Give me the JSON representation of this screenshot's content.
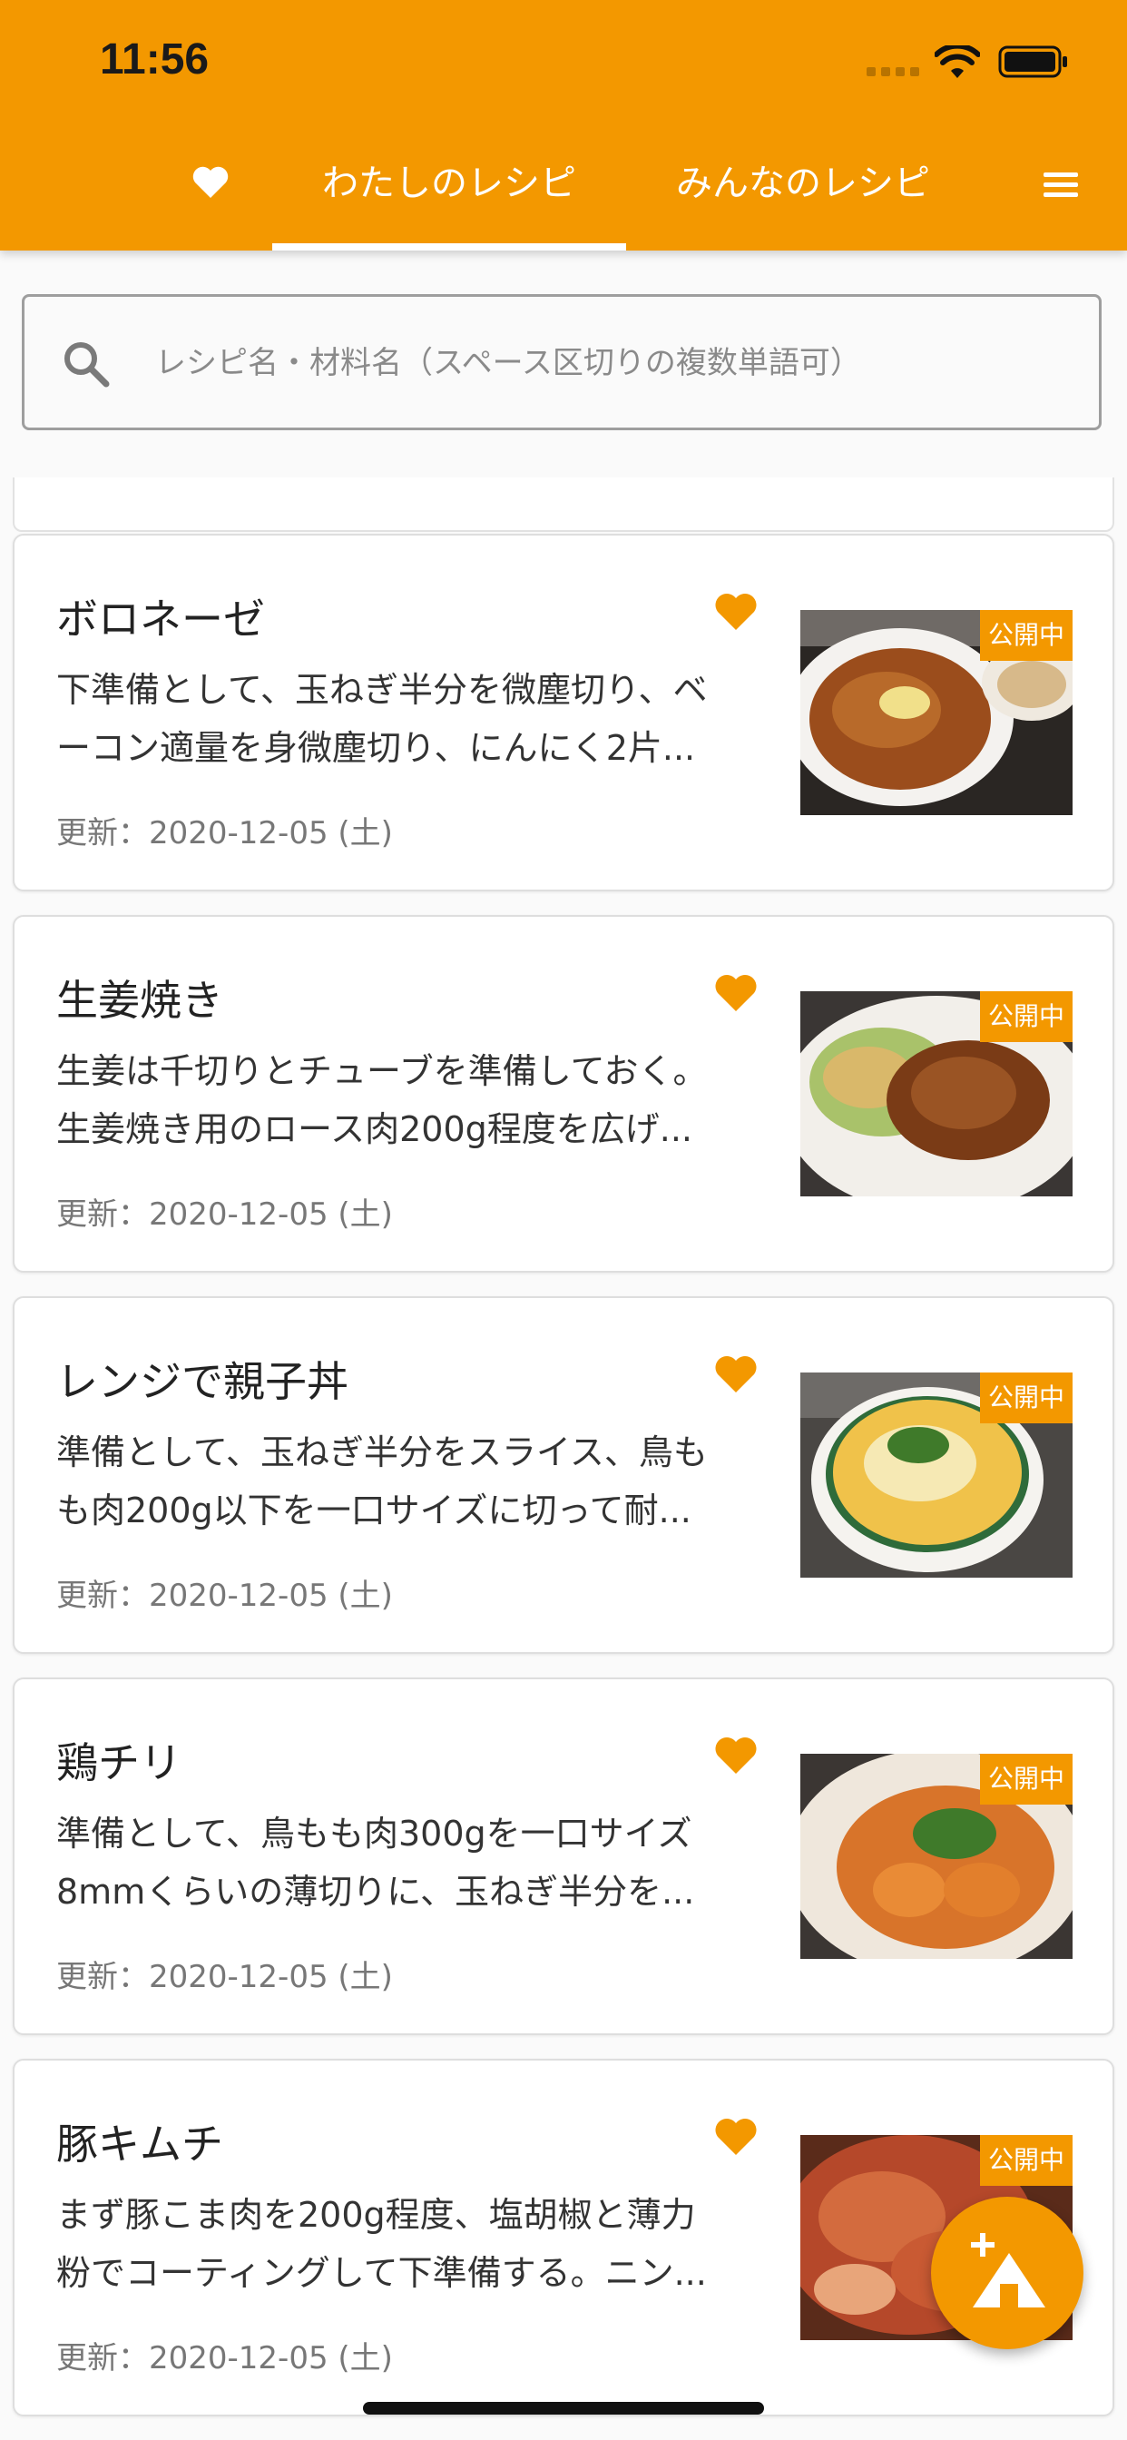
{
  "status_bar": {
    "time": "11:56"
  },
  "app_bar": {
    "tabs": [
      {
        "label": "わたしのレシピ",
        "active": true
      },
      {
        "label": "みんなのレシピ",
        "active": false
      }
    ],
    "colors": {
      "brand": "#F39800",
      "text": "#FFFFFF"
    }
  },
  "search": {
    "placeholder": "レシピ名・材料名（スペース区切りの複数単語可）",
    "value": ""
  },
  "recipes": [
    {
      "title": "ボロネーゼ",
      "desc_line1": "下準備として、玉ねぎ半分を微塵切り、ベ",
      "desc_line2": "ーコン適量を身微塵切り、にんにく2片...",
      "date": "更新：2020-12-05 (土)",
      "badge": "公開中",
      "favorite": true
    },
    {
      "title": "生姜焼き",
      "desc_line1": "生姜は千切りとチューブを準備しておく。",
      "desc_line2": "生姜焼き用のロース肉200g程度を広げ...",
      "date": "更新：2020-12-05 (土)",
      "badge": "公開中",
      "favorite": true
    },
    {
      "title": "レンジで親子丼",
      "desc_line1": "準備として、玉ねぎ半分をスライス、鳥も",
      "desc_line2": "も肉200g以下を一口サイズに切って耐...",
      "date": "更新：2020-12-05 (土)",
      "badge": "公開中",
      "favorite": true
    },
    {
      "title": "鶏チリ",
      "desc_line1": "準備として、鳥もも肉300gを一口サイズ",
      "desc_line2": "8mmくらいの薄切りに、玉ねぎ半分を...",
      "date": "更新：2020-12-05 (土)",
      "badge": "公開中",
      "favorite": true
    },
    {
      "title": "豚キムチ",
      "desc_line1": "まず豚こま肉を200g程度、塩胡椒と薄力",
      "desc_line2": "粉でコーティングして下準備する。ニン...",
      "date": "更新：2020-12-05 (土)",
      "badge": "公開中",
      "favorite": true
    }
  ],
  "icons": {
    "tab_heart": "heart-icon",
    "menu": "menu-icon",
    "search": "search-icon",
    "card_favorite": "heart-icon",
    "fab": "add-recipe-icon"
  }
}
